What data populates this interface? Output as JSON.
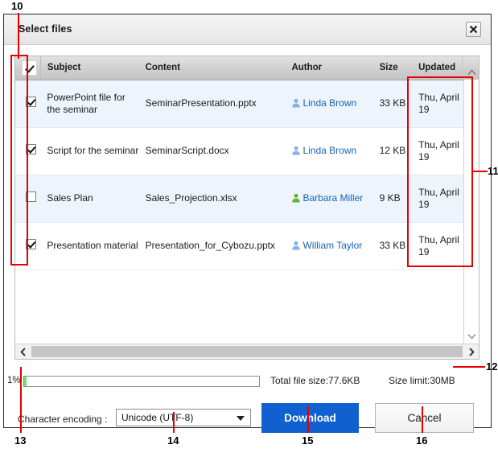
{
  "dialog": {
    "title": "Select files",
    "close_icon": "close-icon"
  },
  "table": {
    "columns": [
      "Subject",
      "Content",
      "Author",
      "Size",
      "Updated"
    ],
    "header_checkbox_checked": true,
    "rows": [
      {
        "checked": true,
        "subject": "PowerPoint file for the seminar",
        "content": "SeminarPresentation.pptx",
        "author": "Linda Brown",
        "author_icon_color": "#7fb2e5",
        "size": "33 KB",
        "updated": "Thu, April 19"
      },
      {
        "checked": true,
        "subject": "Script for the seminar",
        "content": "SeminarScript.docx",
        "author": "Linda Brown",
        "author_icon_color": "#7fb2e5",
        "size": "12 KB",
        "updated": "Thu, April 19"
      },
      {
        "checked": false,
        "subject": "Sales Plan",
        "content": "Sales_Projection.xlsx",
        "author": "Barbara Miller",
        "author_icon_color": "#5cb82a",
        "size": "9 KB",
        "updated": "Thu, April 19"
      },
      {
        "checked": true,
        "subject": "Presentation material",
        "content": "Presentation_for_Cybozu.pptx",
        "author": "William Taylor",
        "author_icon_color": "#7fb2e5",
        "size": "33 KB",
        "updated": "Thu, April 19"
      }
    ]
  },
  "scrollbars": {
    "v_up_icon": "chevron-up-icon",
    "v_down_icon": "chevron-down-icon",
    "h_left_icon": "chevron-left-icon",
    "h_right_icon": "chevron-right-icon"
  },
  "progress": {
    "percent_label": "1%",
    "percent_value": 1,
    "fill_color": "#6ce46c"
  },
  "summary": {
    "total_file_size": "Total file size:77.6KB",
    "size_limit": "Size limit:30MB"
  },
  "footer": {
    "encoding_label": "Character encoding :",
    "encoding_value": "Unicode (UTF-8)",
    "encoding_arrow_icon": "chevron-down-icon",
    "download_label": "Download",
    "download_color": "#1060d0",
    "cancel_label": "Cancel"
  },
  "annotations": {
    "accent_color": "#e60000",
    "markers": [
      {
        "id": "10",
        "label": "10"
      },
      {
        "id": "11",
        "label": "11"
      },
      {
        "id": "12",
        "label": "12"
      },
      {
        "id": "13",
        "label": "13"
      },
      {
        "id": "14",
        "label": "14"
      },
      {
        "id": "15",
        "label": "15"
      },
      {
        "id": "16",
        "label": "16"
      }
    ]
  }
}
